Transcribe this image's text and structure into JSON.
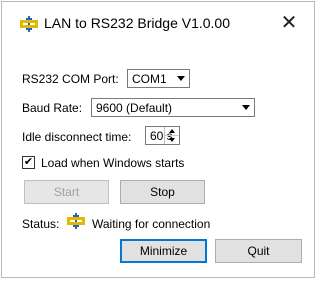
{
  "window": {
    "title": "LAN to RS232 Bridge V1.0.00",
    "close_glyph": "✕",
    "app_icon": "network-bridge-icon"
  },
  "form": {
    "com_port_label": "RS232 COM Port:",
    "com_port_value": "COM1",
    "baud_rate_label": "Baud Rate:",
    "baud_rate_value": "9600 (Default)",
    "idle_label": "Idle disconnect time:",
    "idle_value": "60 s",
    "load_checkbox_label": "Load when Windows starts",
    "load_checkbox_checked": true,
    "load_checkbox_glyph": "✔"
  },
  "buttons": {
    "start": "Start",
    "stop": "Stop",
    "minimize": "Minimize",
    "quit": "Quit"
  },
  "status": {
    "label": "Status:",
    "text": "Waiting for connection",
    "icon": "network-bridge-icon"
  },
  "colors": {
    "icon_yellow": "#e3b800",
    "icon_blue": "#2b63b3",
    "default_button_border": "#0078d7"
  }
}
